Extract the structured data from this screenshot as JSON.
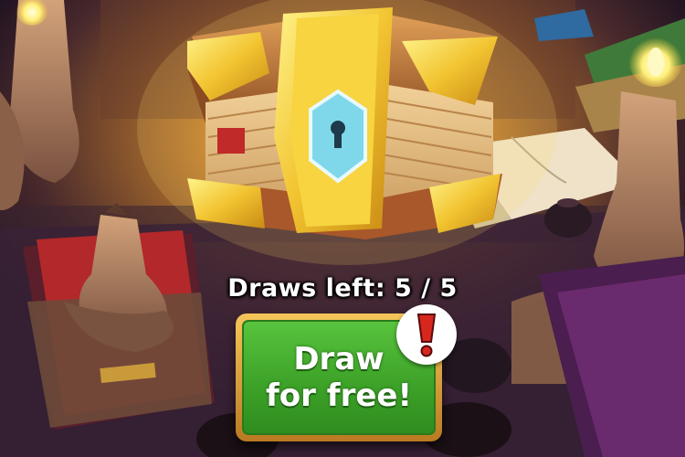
{
  "draws": {
    "label": "Draws left: 5 / 5",
    "remaining": 5,
    "total": 5
  },
  "button": {
    "line1": "Draw",
    "line2": "for free!"
  },
  "icons": {
    "alert": "exclamation-icon",
    "chest": "book-chest-icon"
  },
  "colors": {
    "button_green": "#3ea329",
    "button_frame": "#d9a23a",
    "alert_red": "#d7261e",
    "chest_gold": "#f2c431",
    "candle_wax": "#a97a55"
  }
}
